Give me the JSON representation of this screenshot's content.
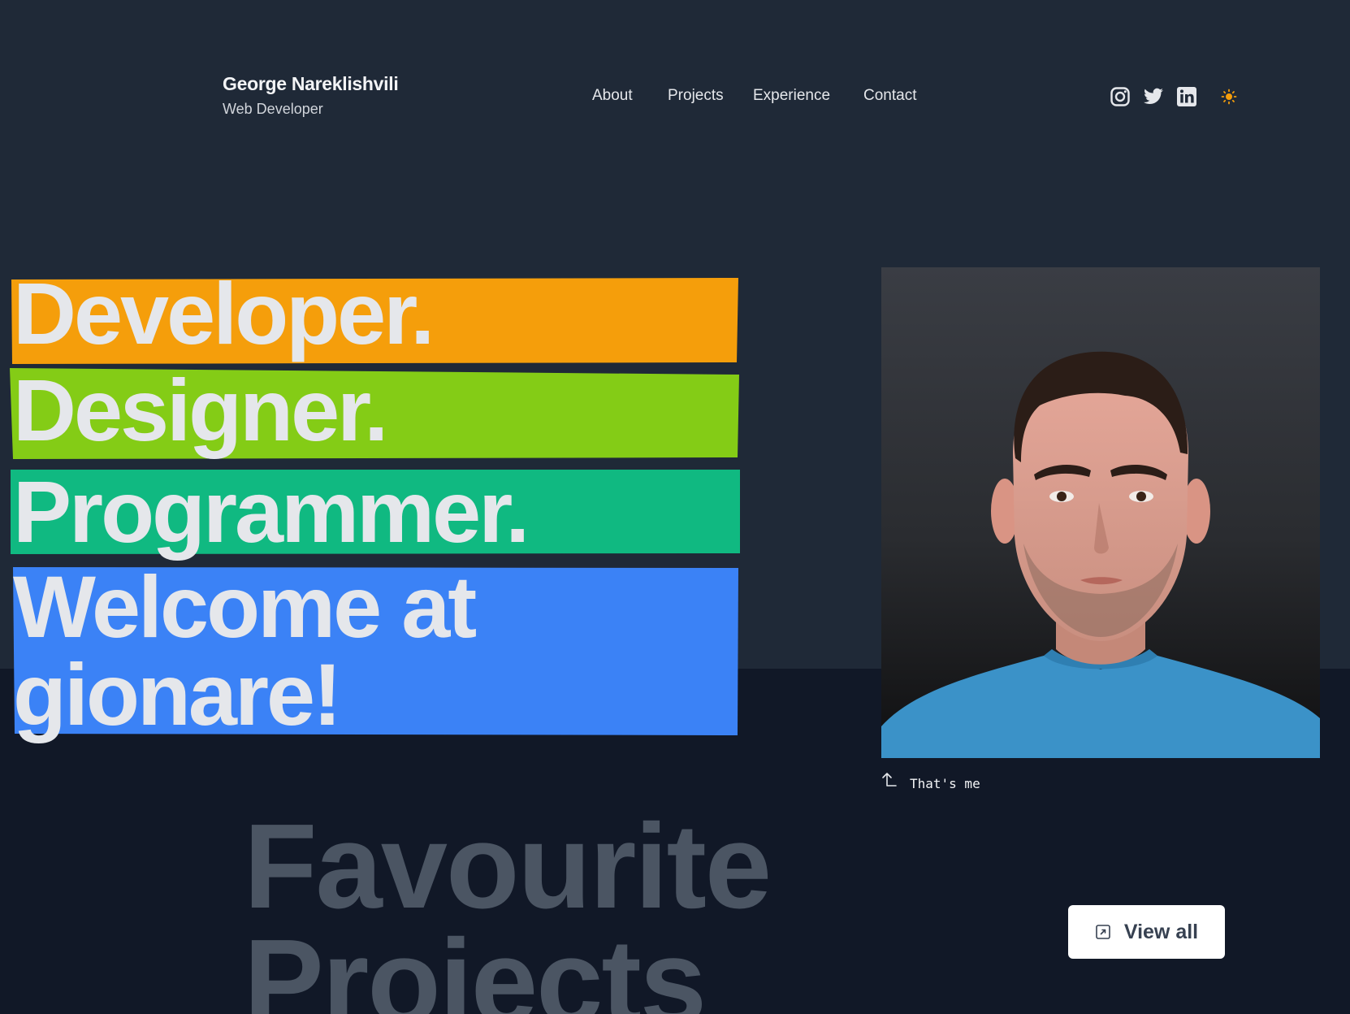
{
  "header": {
    "name": "George Nareklishvili",
    "role": "Web Developer",
    "nav": [
      {
        "label": "About"
      },
      {
        "label": "Projects"
      },
      {
        "label": "Experience"
      },
      {
        "label": "Contact"
      }
    ],
    "socials": [
      {
        "icon": "instagram-icon"
      },
      {
        "icon": "twitter-icon"
      },
      {
        "icon": "linkedin-icon"
      }
    ],
    "theme_toggle_icon": "sun-icon"
  },
  "hero": {
    "lines": [
      {
        "text": "Developer.",
        "color": "#f59e0b"
      },
      {
        "text": "Designer.",
        "color": "#84cc16"
      },
      {
        "text": "Programmer.",
        "color": "#10b981"
      },
      {
        "text": "Welcome at",
        "color": "#3b82f6"
      },
      {
        "text": "gionare!",
        "color": "#3b82f6"
      }
    ]
  },
  "portrait": {
    "caption": "That's me",
    "caption_icon": "corner-up-left-arrow-icon"
  },
  "projects": {
    "heading_line1": "Favourite",
    "heading_line2": "Projects",
    "view_all_label": "View all",
    "view_all_icon": "external-link-icon"
  },
  "colors": {
    "page_bg": "#111827",
    "top_band_bg": "#1f2937",
    "accent_sun": "#f59e0b",
    "text_light": "#e5e7eb",
    "heading_muted": "#4b5563"
  }
}
